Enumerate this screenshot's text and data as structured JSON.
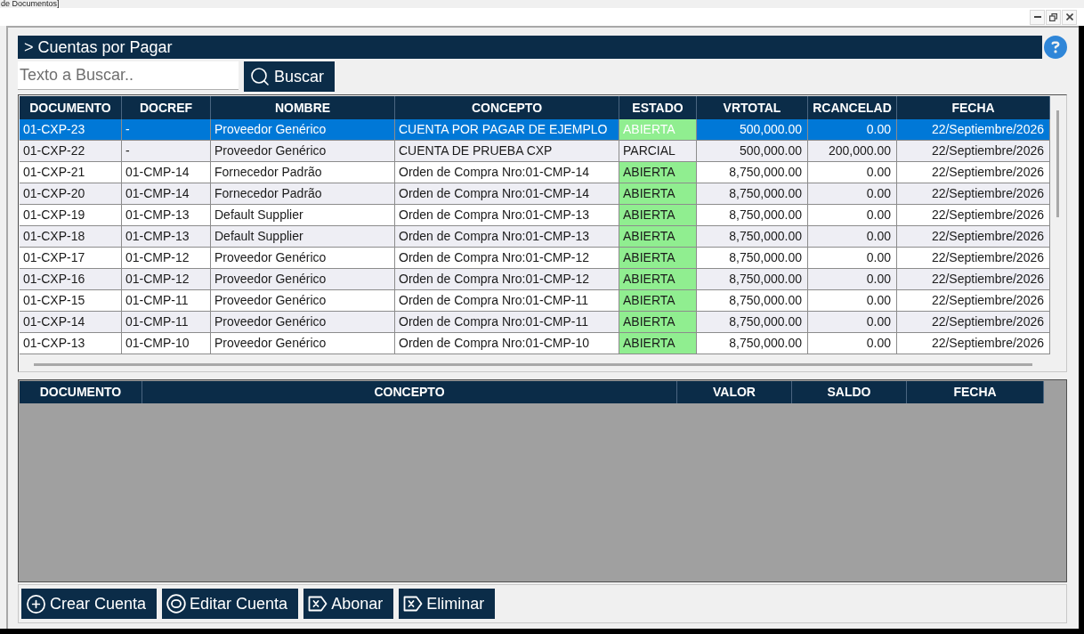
{
  "window": {
    "title": "de Documentos]"
  },
  "header": {
    "title": "> Cuentas por Pagar"
  },
  "search": {
    "placeholder": "Texto a Buscar..",
    "button": "Buscar"
  },
  "accounts_table": {
    "columns": [
      {
        "label": "DOCUMENTO",
        "kind": "text"
      },
      {
        "label": "DOCREF",
        "kind": "text"
      },
      {
        "label": "NOMBRE",
        "kind": "text"
      },
      {
        "label": "CONCEPTO",
        "kind": "text"
      },
      {
        "label": "ESTADO",
        "kind": "status"
      },
      {
        "label": "VRTOTAL",
        "kind": "amount"
      },
      {
        "label": "RCANCELAD",
        "kind": "amount"
      },
      {
        "label": "FECHA",
        "kind": "date"
      }
    ],
    "rows": [
      {
        "selected": true,
        "color": "#90ee90",
        "cells": [
          "01-CXP-23",
          "-",
          "Proveedor Genérico",
          "CUENTA POR PAGAR DE EJEMPLO",
          "ABIERTA",
          "500,000.00",
          "0.00",
          "22/Septiembre/2026"
        ]
      },
      {
        "selected": false,
        "cells": [
          "01-CXP-22",
          "-",
          "Proveedor Genérico",
          "CUENTA DE PRUEBA CXP",
          "PARCIAL",
          "500,000.00",
          "200,000.00",
          "22/Septiembre/2026"
        ]
      },
      {
        "selected": false,
        "color": "#90ee90",
        "cells": [
          "01-CXP-21",
          "01-CMP-14",
          "Fornecedor Padrão",
          "Orden de Compra Nro:01-CMP-14",
          "ABIERTA",
          "8,750,000.00",
          "0.00",
          "22/Septiembre/2026"
        ]
      },
      {
        "selected": false,
        "color": "#90ee90",
        "cells": [
          "01-CXP-20",
          "01-CMP-14",
          "Fornecedor Padrão",
          "Orden de Compra Nro:01-CMP-14",
          "ABIERTA",
          "8,750,000.00",
          "0.00",
          "22/Septiembre/2026"
        ]
      },
      {
        "selected": false,
        "color": "#90ee90",
        "cells": [
          "01-CXP-19",
          "01-CMP-13",
          "Default Supplier",
          "Orden de Compra Nro:01-CMP-13",
          "ABIERTA",
          "8,750,000.00",
          "0.00",
          "22/Septiembre/2026"
        ]
      },
      {
        "selected": false,
        "color": "#90ee90",
        "cells": [
          "01-CXP-18",
          "01-CMP-13",
          "Default Supplier",
          "Orden de Compra Nro:01-CMP-13",
          "ABIERTA",
          "8,750,000.00",
          "0.00",
          "22/Septiembre/2026"
        ]
      },
      {
        "selected": false,
        "color": "#90ee90",
        "cells": [
          "01-CXP-17",
          "01-CMP-12",
          "Proveedor Genérico",
          "Orden de Compra Nro:01-CMP-12",
          "ABIERTA",
          "8,750,000.00",
          "0.00",
          "22/Septiembre/2026"
        ]
      },
      {
        "selected": false,
        "color": "#90ee90",
        "cells": [
          "01-CXP-16",
          "01-CMP-12",
          "Proveedor Genérico",
          "Orden de Compra Nro:01-CMP-12",
          "ABIERTA",
          "8,750,000.00",
          "0.00",
          "22/Septiembre/2026"
        ]
      },
      {
        "selected": false,
        "color": "#90ee90",
        "cells": [
          "01-CXP-15",
          "01-CMP-11",
          "Proveedor Genérico",
          "Orden de Compra Nro:01-CMP-11",
          "ABIERTA",
          "8,750,000.00",
          "0.00",
          "22/Septiembre/2026"
        ]
      },
      {
        "selected": false,
        "color": "#90ee90",
        "cells": [
          "01-CXP-14",
          "01-CMP-11",
          "Proveedor Genérico",
          "Orden de Compra Nro:01-CMP-11",
          "ABIERTA",
          "8,750,000.00",
          "0.00",
          "22/Septiembre/2026"
        ]
      },
      {
        "selected": false,
        "color": "#90ee90",
        "cells": [
          "01-CXP-13",
          "01-CMP-10",
          "Proveedor Genérico",
          "Orden de Compra Nro:01-CMP-10",
          "ABIERTA",
          "8,750,000.00",
          "0.00",
          "22/Septiembre/2026"
        ]
      }
    ]
  },
  "details_table": {
    "columns": [
      "DOCUMENTO",
      "CONCEPTO",
      "VALOR",
      "SALDO",
      "FECHA"
    ]
  },
  "actions": [
    {
      "label": "Crear Cuenta",
      "kind": "create"
    },
    {
      "label": "Editar Cuenta",
      "kind": "edit"
    },
    {
      "label": "Abonar",
      "kind": "pay"
    },
    {
      "label": "Eliminar",
      "kind": "delete"
    }
  ]
}
